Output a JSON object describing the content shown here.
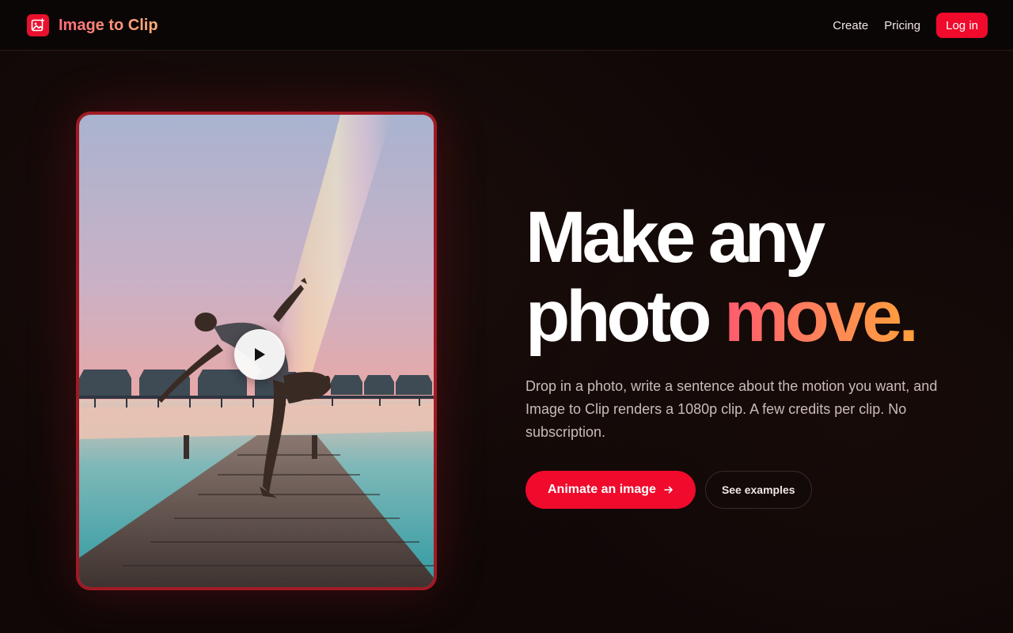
{
  "header": {
    "brand_name": "Image to Clip",
    "nav": {
      "create": "Create",
      "pricing": "Pricing"
    },
    "login_label": "Log in"
  },
  "hero": {
    "headline_line1": "Make any",
    "headline_line2_plain": "photo ",
    "headline_line2_accent": "move.",
    "subtext": "Drop in a photo, write a sentence about the motion you want, and Image to Clip renders a 1080p clip. A few credits per clip. No subscription.",
    "primary_cta": "Animate an image",
    "primary_cta_icon": "arrow-right-icon",
    "secondary_cta": "See examples"
  },
  "media": {
    "icon": "play-icon"
  },
  "colors": {
    "accent": "#f00a2c",
    "background": "#0f0807",
    "card_border": "#a01a24"
  }
}
